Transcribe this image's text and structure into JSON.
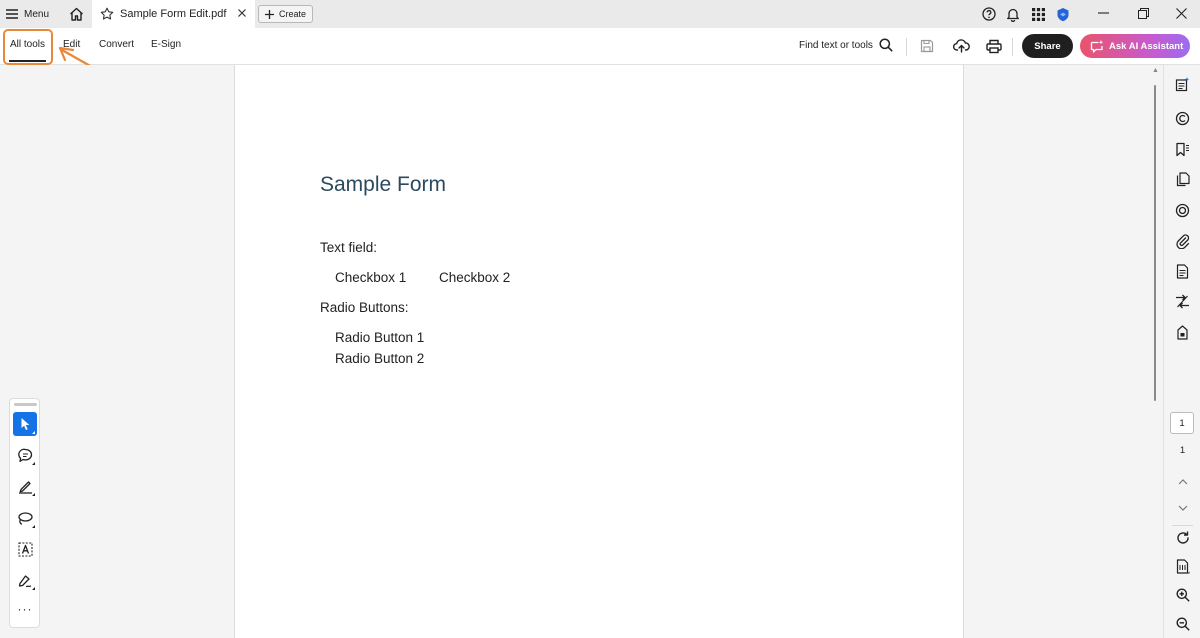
{
  "titlebar": {
    "menu_label": "Menu",
    "tab_title": "Sample Form Edit.pdf",
    "create_label": "Create",
    "icons": [
      "hamburger-icon",
      "home-icon",
      "star-icon",
      "close-icon",
      "plus-icon",
      "help-icon",
      "bell-icon",
      "apps-grid-icon",
      "adobe-shield-icon",
      "minimize-icon",
      "restore-icon",
      "window-close-icon"
    ]
  },
  "toolbar": {
    "tabs": [
      {
        "label": "All tools",
        "active": true
      },
      {
        "label": "Edit",
        "active": false
      },
      {
        "label": "Convert",
        "active": false
      },
      {
        "label": "E-Sign",
        "active": false
      }
    ],
    "find_label": "Find text or tools",
    "share_label": "Share",
    "ai_label": "Ask AI Assistant",
    "accent": "#e8883a",
    "icons": [
      "search-icon",
      "save-icon",
      "upload-cloud-icon",
      "print-icon",
      "ai-chat-icon"
    ]
  },
  "document": {
    "title": "Sample Form",
    "lines": [
      "Text field:",
      "Checkbox 1",
      "Checkbox 2",
      "Radio Buttons:",
      "Radio Button 1",
      "Radio Button 2"
    ],
    "title_color": "#2c4a5f"
  },
  "right_rail": {
    "current_page": "1",
    "total_pages": "1",
    "icons": [
      "comment-panel-icon",
      "export-pdf-icon",
      "bookmark-icon",
      "pages-icon",
      "layers-icon",
      "attachment-icon",
      "document-properties-icon",
      "compare-icon",
      "lock-icon",
      "chevron-up-icon",
      "chevron-down-icon",
      "rotate-icon",
      "page-fit-icon",
      "zoom-in-icon",
      "zoom-out-icon"
    ]
  },
  "quick_tools": {
    "active": "select",
    "icons": [
      "cursor-icon",
      "comment-icon",
      "highlight-pen-icon",
      "lasso-icon",
      "text-box-icon",
      "sign-pen-icon"
    ],
    "more_label": "···",
    "active_color": "#1473e6"
  }
}
